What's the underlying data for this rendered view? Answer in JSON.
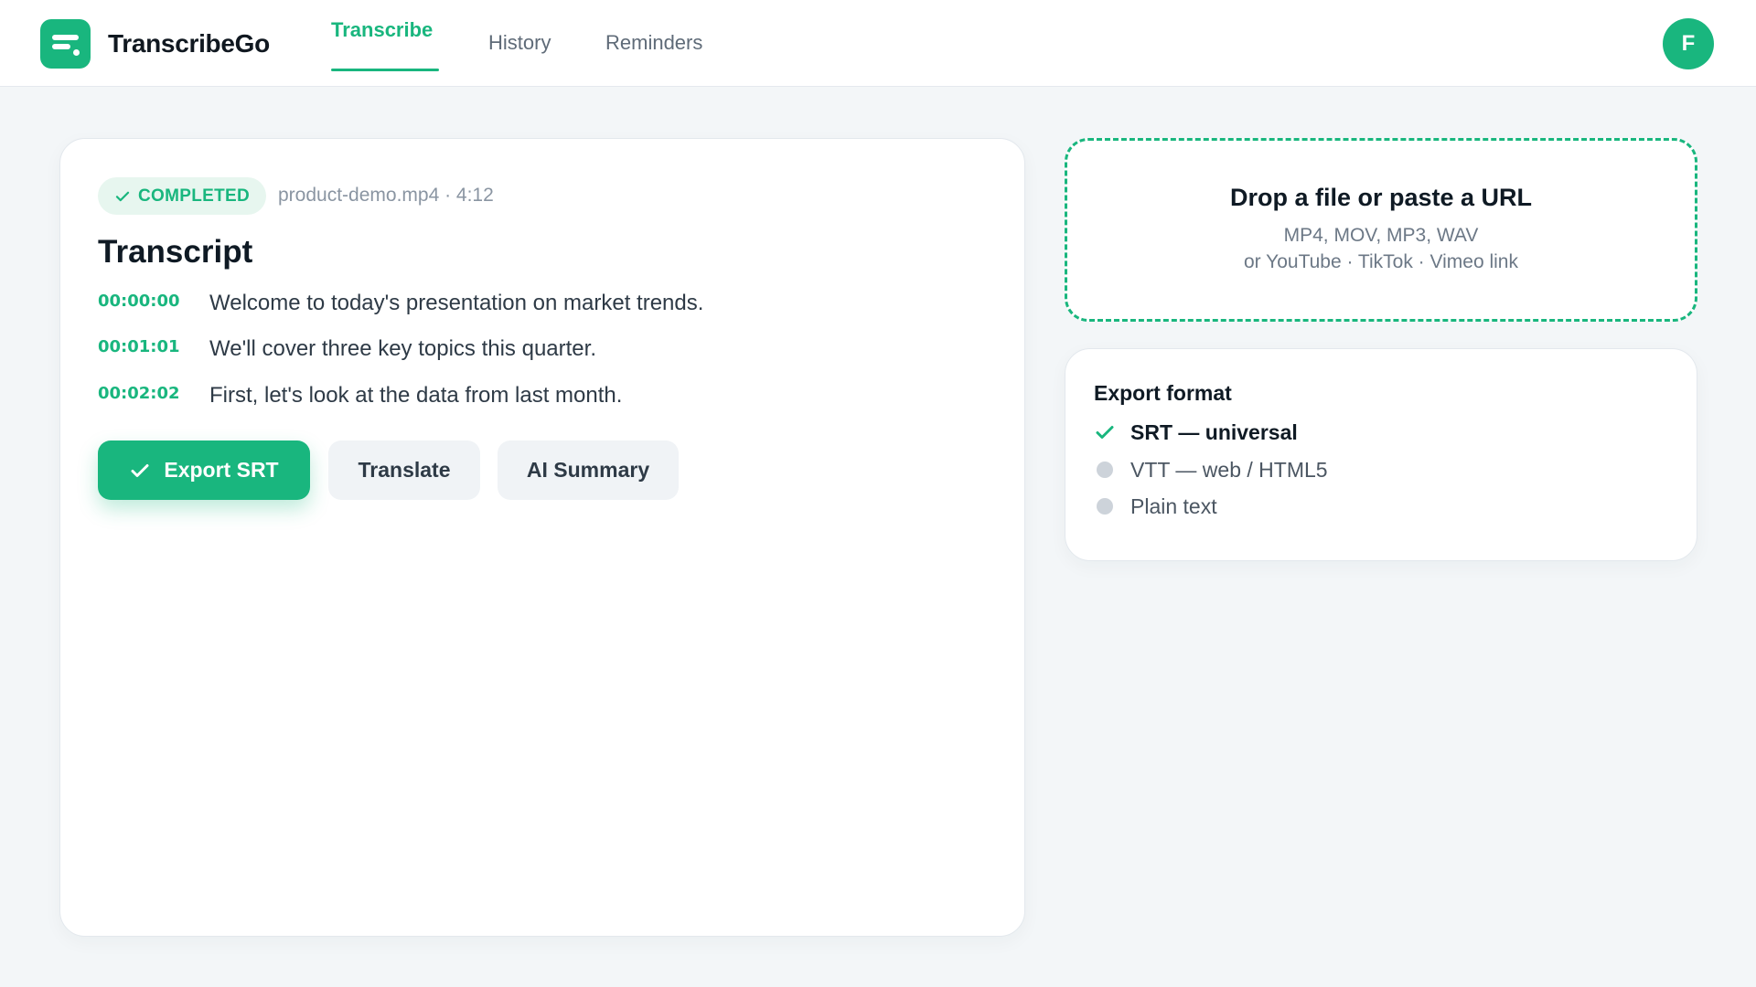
{
  "app": {
    "name": "TranscribeGo",
    "avatar_initial": "F"
  },
  "nav": {
    "tabs": [
      {
        "label": "Transcribe",
        "active": true
      },
      {
        "label": "History",
        "active": false
      },
      {
        "label": "Reminders",
        "active": false
      }
    ]
  },
  "transcript": {
    "status": "COMPLETED",
    "file_meta": "product-demo.mp4 · 4:12",
    "title": "Transcript",
    "segments": [
      {
        "time": "00:00:00",
        "text": "Welcome to today's presentation on market trends."
      },
      {
        "time": "00:01:01",
        "text": "We'll cover three key topics this quarter."
      },
      {
        "time": "00:02:02",
        "text": "First, let's look at the data from last month."
      }
    ],
    "actions": {
      "export": "Export SRT",
      "translate": "Translate",
      "summary": "AI Summary"
    }
  },
  "dropzone": {
    "title": "Drop a file or paste a URL",
    "formats": "MP4, MOV, MP3, WAV",
    "links": "or YouTube · TikTok · Vimeo link"
  },
  "export_format": {
    "title": "Export format",
    "options": [
      {
        "label": "SRT — universal",
        "selected": true
      },
      {
        "label": "VTT — web / HTML5",
        "selected": false
      },
      {
        "label": "Plain text",
        "selected": false
      }
    ]
  },
  "colors": {
    "accent": "#19b67e",
    "background": "#f3f6f8",
    "text": "#0f1a24",
    "muted": "#8a95a2"
  },
  "icons": {
    "logo": "subtitles-logo-icon",
    "check": "check-icon",
    "radio_unselected": "radio-dot-icon"
  }
}
